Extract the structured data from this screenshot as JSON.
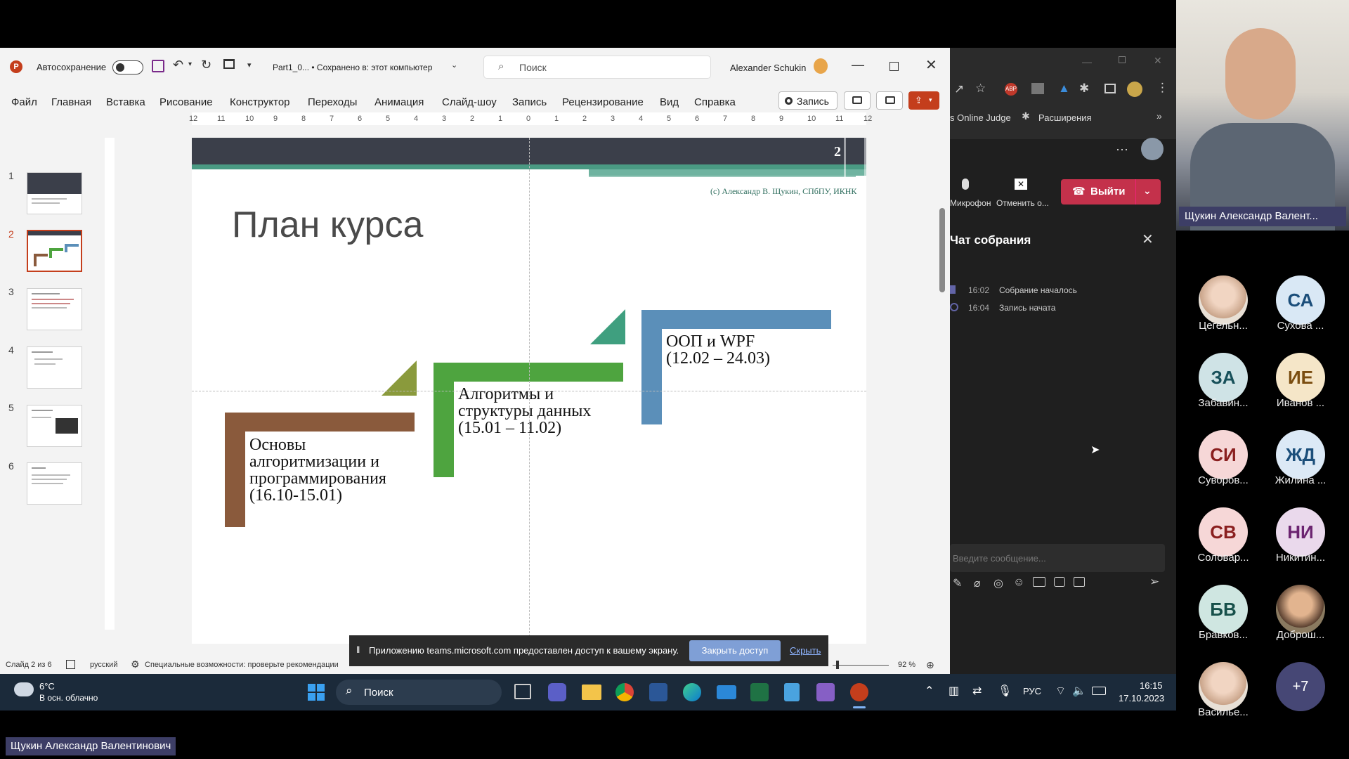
{
  "ppt": {
    "autosave_label": "Автосохранение",
    "file_title": "Part1_0... • Сохранено в: этот компьютер",
    "search_placeholder": "Поиск",
    "user_name": "Alexander Schukin",
    "menu": [
      "Файл",
      "Главная",
      "Вставка",
      "Рисование",
      "Конструктор",
      "Переходы",
      "Анимация",
      "Слайд-шоу",
      "Запись",
      "Рецензирование",
      "Вид",
      "Справка"
    ],
    "record_button": "Запись",
    "ruler_top": [
      "12",
      "11",
      "10",
      "9",
      "8",
      "7",
      "6",
      "5",
      "4",
      "3",
      "2",
      "1",
      "0",
      "1",
      "2",
      "3",
      "4",
      "5",
      "6",
      "7",
      "8",
      "9",
      "10",
      "11",
      "12"
    ],
    "thumb_numbers": [
      "1",
      "2",
      "3",
      "4",
      "5",
      "6"
    ],
    "status": {
      "slide_counter": "Слайд 2 из 6",
      "language": "русский",
      "accessibility": "Специальные возможности: проверьте рекомендации",
      "zoom": "92 %"
    }
  },
  "slide": {
    "number": "2",
    "copyright": "(c) Александр В. Щукин, СПбПУ, ИКНК",
    "title": "План курса",
    "step1": "Основы алгоритмизации и программирования (16.10-15.01)",
    "step1_lines": [
      "Основы",
      "алгоритмизации и",
      "программирования",
      "(16.10-15.01)"
    ],
    "step2_lines": [
      "Алгоритмы и",
      "структуры данных",
      "(15.01 – 11.02)"
    ],
    "step3_lines": [
      "ООП и WPF",
      "(12.02 – 24.03)"
    ],
    "colors": {
      "step1": "#8a5a3c",
      "step2": "#4ea43f",
      "step3": "#5b8fb9",
      "header": "#3b3f4a",
      "accent": "#4a9a83"
    }
  },
  "banner": {
    "text": "Приложению teams.microsoft.com предоставлен доступ к вашему экрану.",
    "stop_button": "Закрыть доступ",
    "hide_link": "Скрыть"
  },
  "teams": {
    "bookmark1": "s Online Judge",
    "bookmark2": "Расширения",
    "mic_label": "Микрофон",
    "cancel_label": "Отменить о...",
    "leave_button": "Выйти",
    "chat_title": "Чат собрания",
    "events": [
      {
        "time": "16:02",
        "text": "Собрание началось"
      },
      {
        "time": "16:04",
        "text": "Запись начата"
      }
    ],
    "message_placeholder": "Введите сообщение..."
  },
  "taskbar": {
    "weather_temp": "6°C",
    "weather_desc": "В осн. облачно",
    "search_label": "Поиск",
    "lang": "РУС",
    "time": "16:15",
    "date": "17.10.2023"
  },
  "speaker": {
    "name_tag": "Щукин Александр Валент...",
    "bottom_name": "Щукин Александр Валентинович"
  },
  "participants": [
    {
      "initials": "",
      "name": "Цегельн...",
      "photo": true
    },
    {
      "initials": "СА",
      "name": "Сухова ...",
      "photo": false,
      "bg": "#d9e8f5",
      "fg": "#1b4e7a"
    },
    {
      "initials": "ЗА",
      "name": "Забавин...",
      "photo": false,
      "bg": "#cfe3e6",
      "fg": "#17505a"
    },
    {
      "initials": "ИЕ",
      "name": "Иванов ...",
      "photo": false,
      "bg": "#f5e6c8",
      "fg": "#7a4d10"
    },
    {
      "initials": "СИ",
      "name": "Суворов...",
      "photo": false,
      "bg": "#f6d7d7",
      "fg": "#8a1f1f"
    },
    {
      "initials": "ЖД",
      "name": "Жилина ...",
      "photo": false,
      "bg": "#dce9f6",
      "fg": "#1b4e7a"
    },
    {
      "initials": "СВ",
      "name": "Соловар...",
      "photo": false,
      "bg": "#f6d7d7",
      "fg": "#8a1f1f"
    },
    {
      "initials": "НИ",
      "name": "Никитин...",
      "photo": false,
      "bg": "#ead9ec",
      "fg": "#6b2470"
    },
    {
      "initials": "БВ",
      "name": "Бравков...",
      "photo": false,
      "bg": "#cfe6e1",
      "fg": "#17504a"
    },
    {
      "initials": "",
      "name": "Доброш...",
      "photo": true
    },
    {
      "initials": "",
      "name": "Василье...",
      "photo": true
    },
    {
      "initials": "+7",
      "name": "",
      "photo": false,
      "bg": "#464775",
      "fg": "#ffffff"
    }
  ]
}
